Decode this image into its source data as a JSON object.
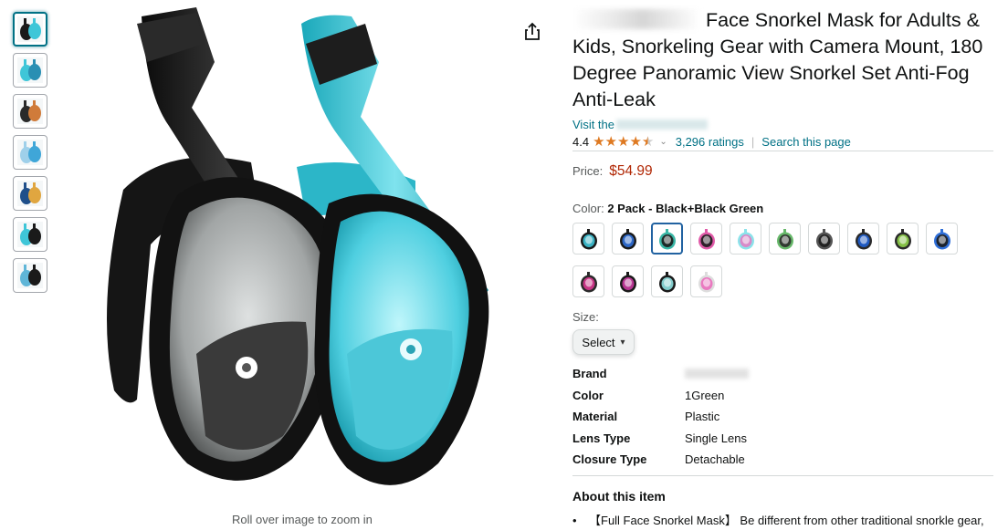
{
  "thumbnails": [
    {
      "name": "thumb-1",
      "active": true
    },
    {
      "name": "thumb-2",
      "active": false
    },
    {
      "name": "thumb-3",
      "active": false
    },
    {
      "name": "thumb-4",
      "active": false
    },
    {
      "name": "thumb-5",
      "active": false
    },
    {
      "name": "thumb-6",
      "active": false
    },
    {
      "name": "thumb-7",
      "active": false
    }
  ],
  "image": {
    "zoom_hint": "Roll over image to zoom in"
  },
  "product": {
    "title_brand_obscured": "",
    "title": "Face Snorkel Mask for Adults & Kids, Snorkeling Gear with Camera Mount, 180 Degree Panoramic View Snorkel Set Anti-Fog Anti-Leak",
    "store_link_prefix": "Visit the",
    "rating": "4.4",
    "rating_stars": 4.4,
    "ratings_count": "3,296 ratings",
    "search_page": "Search this page",
    "price_label": "Price:",
    "price": "$54.99",
    "color_label": "Color:",
    "color_value": "2 Pack - Black+Black Green",
    "size_label": "Size:",
    "size_select": "Select"
  },
  "swatches": [
    {
      "color": "#3ec3d6",
      "accent": "#1a1a1a"
    },
    {
      "color": "#2f6fd8",
      "accent": "#1a1a1a"
    },
    {
      "color": "#1b1b1b",
      "accent": "#3ab7a6",
      "selected": true
    },
    {
      "color": "#1b1b1b",
      "accent": "#e05aa8"
    },
    {
      "color": "#e07fc4",
      "accent": "#8be3ea"
    },
    {
      "color": "#2b2b2b",
      "accent": "#67b86a"
    },
    {
      "color": "#1d1d1d",
      "accent": "#555555"
    },
    {
      "color": "#1f5fd0",
      "accent": "#2a2a2a"
    },
    {
      "color": "#8fd04a",
      "accent": "#2a2a2a"
    },
    {
      "color": "#1c1c1c",
      "accent": "#2f6fd8"
    },
    {
      "color": "#d8368f",
      "accent": "#2a2a2a"
    },
    {
      "color": "#c93aa0",
      "accent": "#1a1a1a"
    },
    {
      "color": "#8fe0e0",
      "accent": "#1a1a1a"
    },
    {
      "color": "#ea6fbd",
      "accent": "#dddddd"
    }
  ],
  "specs": [
    {
      "key": "Brand",
      "value": ""
    },
    {
      "key": "Color",
      "value": "1Green"
    },
    {
      "key": "Material",
      "value": "Plastic"
    },
    {
      "key": "Lens Type",
      "value": "Single Lens"
    },
    {
      "key": "Closure Type",
      "value": "Detachable"
    }
  ],
  "about": {
    "title": "About this item",
    "bullet_1": "【Full Face Snorkel Mask】 Be different from other traditional snorkle gear,"
  },
  "colors": {
    "link": "#007185",
    "price": "#b12704",
    "star": "#de7921",
    "mask_black": "#1c1c1c",
    "mask_aqua": "#3fc6d8"
  }
}
